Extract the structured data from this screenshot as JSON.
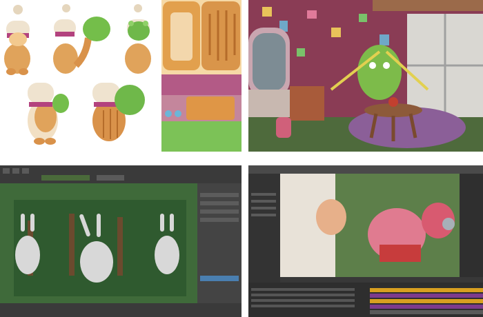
{
  "panels": [
    {
      "id": "character-turnaround",
      "caption": ""
    },
    {
      "id": "room-scene",
      "caption": ""
    },
    {
      "id": "maya-viewport",
      "caption": ""
    },
    {
      "id": "compositing-editor",
      "caption": ""
    }
  ],
  "colors": {
    "fur_orange": "#e0a35b",
    "hat_cream": "#efe3cf",
    "leaf_green": "#6fb84a",
    "room_wall": "#8a3c55",
    "rug_purple": "#8b5f98",
    "viewport_green": "#3f6a3a",
    "ui_dark": "#2b2b2b",
    "timeline_orange": "#d8a020",
    "timeline_purple": "#7d3b8c"
  },
  "icons": [
    "character-icon",
    "cactus-icon",
    "bunny-icon",
    "pig-icon"
  ]
}
